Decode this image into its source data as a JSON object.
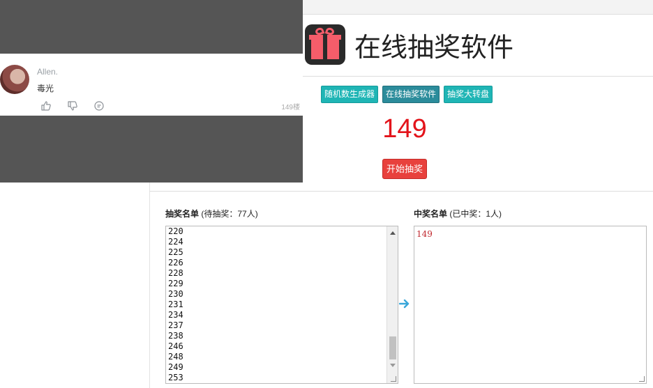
{
  "app": {
    "title": "在线抽奖软件"
  },
  "tabs": [
    {
      "label": "随机数生成器",
      "active": false
    },
    {
      "label": "在线抽奖软件",
      "active": true
    },
    {
      "label": "抽奖大转盘",
      "active": false
    }
  ],
  "draw": {
    "result": "149",
    "start_label": "开始抽奖"
  },
  "pool": {
    "label_bold": "抽奖名单",
    "label_rest": " (待抽奖：77人)",
    "entries": [
      "220",
      "224",
      "225",
      "226",
      "228",
      "229",
      "230",
      "231",
      "234",
      "237",
      "238",
      "246",
      "248",
      "249",
      "253"
    ]
  },
  "winners": {
    "label_bold": "中奖名单",
    "label_rest": " (已中奖：1人)",
    "text": "149"
  },
  "comment": {
    "username": "Allen.",
    "text": "毒光",
    "floor": "149楼"
  },
  "colors": {
    "result": "#e3141b",
    "tab": "#1fb5b5",
    "start": "#e8413d"
  }
}
